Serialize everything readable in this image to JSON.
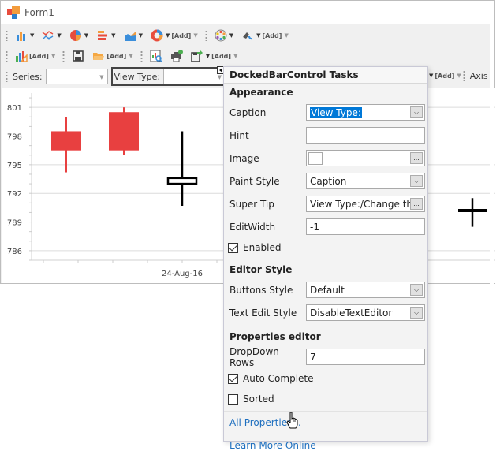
{
  "window": {
    "title": "Form1"
  },
  "toolbar1": {
    "items": [
      {
        "icon": "bar-chart-icon"
      },
      {
        "icon": "line-chart-icon"
      },
      {
        "icon": "pie-chart-icon"
      },
      {
        "icon": "horizontal-bar-chart-icon"
      },
      {
        "icon": "area-chart-icon"
      },
      {
        "icon": "doughnut-chart-icon"
      }
    ],
    "add_label_1": "[Add]",
    "palette_icon": "palette-icon",
    "appearance_icon": "appearance-icon",
    "add_label_2": "[Add]"
  },
  "toolbar2": {
    "add_label_1": "[Add]",
    "add_label_2": "[Add]",
    "add_label_3": "[Add]"
  },
  "toolbar3": {
    "series_label": "Series:",
    "series_value": "",
    "view_type_label": "View Type:",
    "view_type_value": "",
    "add_label": "[Add]",
    "axis_label": "Axis"
  },
  "chart_data": {
    "type": "candlestick",
    "y_ticks": [
      "801",
      "798",
      "795",
      "792",
      "789",
      "786"
    ],
    "ylim": [
      785,
      802.5
    ],
    "x_label": "24-Aug-16",
    "candles": [
      {
        "open": 798.5,
        "close": 796.5,
        "high": 800,
        "low": 794.2,
        "color": "#e84040"
      },
      {
        "open": 800.5,
        "close": 796.5,
        "high": 801,
        "low": 796,
        "color": "#e84040"
      },
      {
        "open": 793,
        "close": 793.6,
        "high": 798.5,
        "low": 790.7,
        "color": "#000000"
      },
      {
        "open": 790.2,
        "close": 790.2,
        "high": 791.5,
        "low": 788.5,
        "color": "#000000"
      }
    ]
  },
  "panel": {
    "title": "DockedBarControl Tasks",
    "appearance_section": "Appearance",
    "caption_label": "Caption",
    "caption_value": "View Type:",
    "hint_label": "Hint",
    "hint_value": "",
    "image_label": "Image",
    "paint_style_label": "Paint Style",
    "paint_style_value": "Caption",
    "super_tip_label": "Super Tip",
    "super_tip_value": "View Type:/Change the",
    "edit_width_label": "EditWidth",
    "edit_width_value": "-1",
    "enabled_label": "Enabled",
    "enabled_checked": true,
    "editor_style_section": "Editor Style",
    "buttons_style_label": "Buttons Style",
    "buttons_style_value": "Default",
    "text_edit_style_label": "Text Edit Style",
    "text_edit_style_value": "DisableTextEditor",
    "properties_editor_section": "Properties editor",
    "dropdown_rows_label": "DropDown Rows",
    "dropdown_rows_value": "7",
    "auto_complete_label": "Auto Complete",
    "auto_complete_checked": true,
    "sorted_label": "Sorted",
    "sorted_checked": false,
    "all_properties_link": "All Properties...",
    "learn_more_link": "Learn More Online",
    "ellipsis": "..."
  }
}
